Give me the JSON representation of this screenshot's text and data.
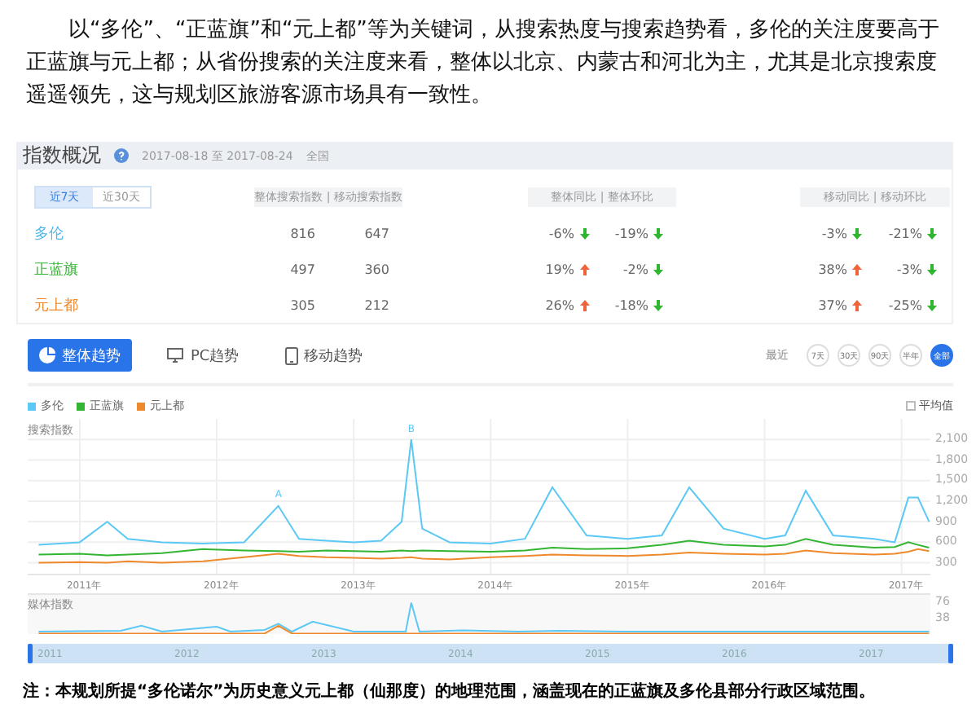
{
  "paragraph": "以“多伦”、“正蓝旗”和“元上都”等为关键词，从搜索热度与搜索趋势看，多伦的关注度要高于正蓝旗与元上都；从省份搜索的关注度来看，整体以北京、内蒙古和河北为主，尤其是北京搜索度遥遥领先，这与规划区旅游客源市场具有一致性。",
  "summary": {
    "title": "指数概况",
    "date_range": "2017-08-18 至 2017-08-24",
    "region": "全国",
    "periods": [
      {
        "label": "近7天",
        "selected": true
      },
      {
        "label": "近30天",
        "selected": false
      }
    ],
    "header_groups": [
      [
        "整体搜索指数",
        "移动搜索指数"
      ],
      [
        "整体同比",
        "整体环比"
      ],
      [
        "移动同比",
        "移动环比"
      ]
    ],
    "separator": "|",
    "rows": [
      {
        "name": "多伦",
        "color": "#4fb6ea",
        "values": [
          {
            "text": "816"
          },
          {
            "text": "647"
          },
          {
            "text": "-6%",
            "rising": false
          },
          {
            "text": "-19%",
            "rising": false
          },
          {
            "text": "-3%",
            "rising": false
          },
          {
            "text": "-21%",
            "rising": false
          }
        ]
      },
      {
        "name": "正蓝旗",
        "color": "#33b533",
        "values": [
          {
            "text": "497"
          },
          {
            "text": "360"
          },
          {
            "text": "19%",
            "rising": true
          },
          {
            "text": "-2%",
            "rising": false
          },
          {
            "text": "38%",
            "rising": true
          },
          {
            "text": "-3%",
            "rising": false
          }
        ]
      },
      {
        "name": "元上都",
        "color": "#ef8a2c",
        "values": [
          {
            "text": "305"
          },
          {
            "text": "212"
          },
          {
            "text": "26%",
            "rising": true
          },
          {
            "text": "-18%",
            "rising": false
          },
          {
            "text": "37%",
            "rising": true
          },
          {
            "text": "-25%",
            "rising": false
          }
        ]
      }
    ]
  },
  "trend": {
    "modes": [
      {
        "label": "整体趋势",
        "kind": "all",
        "selected": true
      },
      {
        "label": "PC趋势",
        "kind": "pc",
        "selected": false
      },
      {
        "label": "移动趋势",
        "kind": "mobile",
        "selected": false
      }
    ],
    "range_label": "最近",
    "ranges": [
      {
        "label": "7天",
        "selected": false
      },
      {
        "label": "30天",
        "selected": false
      },
      {
        "label": "90天",
        "selected": false
      },
      {
        "label": "半年",
        "selected": false
      },
      {
        "label": "全部",
        "selected": true
      }
    ],
    "average": {
      "label": "平均值",
      "checked": false
    },
    "chart_data": {
      "type": "line",
      "ylabel": "搜索指数",
      "x": [
        2010.7,
        2011.0,
        2011.2,
        2011.35,
        2011.6,
        2011.9,
        2012.2,
        2012.45,
        2012.6,
        2012.8,
        2013.0,
        2013.2,
        2013.35,
        2013.42,
        2013.5,
        2013.7,
        2014.0,
        2014.25,
        2014.45,
        2014.7,
        2015.0,
        2015.25,
        2015.45,
        2015.7,
        2016.0,
        2016.15,
        2016.3,
        2016.5,
        2016.8,
        2016.95,
        2017.05,
        2017.12,
        2017.2
      ],
      "series": [
        {
          "name": "多伦",
          "color": "#5cc8f5",
          "values": [
            560,
            600,
            900,
            650,
            600,
            580,
            600,
            1130,
            650,
            620,
            600,
            620,
            900,
            2100,
            800,
            600,
            580,
            650,
            1400,
            700,
            650,
            700,
            1400,
            800,
            650,
            700,
            1350,
            700,
            650,
            600,
            1250,
            1250,
            900
          ]
        },
        {
          "name": "正蓝旗",
          "color": "#33b533",
          "values": [
            420,
            430,
            410,
            420,
            440,
            500,
            480,
            470,
            460,
            480,
            470,
            460,
            480,
            470,
            480,
            470,
            460,
            480,
            520,
            500,
            510,
            560,
            620,
            560,
            540,
            560,
            650,
            560,
            520,
            530,
            600,
            560,
            520
          ]
        },
        {
          "name": "元上都",
          "color": "#ef8a2c",
          "values": [
            300,
            310,
            300,
            320,
            300,
            320,
            380,
            430,
            400,
            380,
            370,
            360,
            370,
            380,
            360,
            350,
            380,
            400,
            420,
            410,
            400,
            420,
            450,
            430,
            420,
            430,
            480,
            440,
            420,
            430,
            460,
            500,
            470
          ]
        }
      ],
      "grid": true,
      "xlim": [
        2010.62,
        2017.21
      ],
      "ylim": [
        140,
        2400
      ],
      "xticks": [
        {
          "value": 2011,
          "label": "2011年"
        },
        {
          "value": 2012,
          "label": "2012年"
        },
        {
          "value": 2013,
          "label": "2013年"
        },
        {
          "value": 2014,
          "label": "2014年"
        },
        {
          "value": 2015,
          "label": "2015年"
        },
        {
          "value": 2016,
          "label": "2016年"
        },
        {
          "value": 2017,
          "label": "2017年"
        }
      ],
      "yticks": [
        {
          "value": 2100,
          "label": "2,100"
        },
        {
          "value": 1800,
          "label": "1,800"
        },
        {
          "value": 1500,
          "label": "1,500"
        },
        {
          "value": 1200,
          "label": "1,200"
        },
        {
          "value": 900,
          "label": "900"
        },
        {
          "value": 600,
          "label": "600"
        },
        {
          "value": 300,
          "label": "300"
        }
      ],
      "annotations": [
        {
          "x": 2012.45,
          "y": 1130,
          "text": "A"
        },
        {
          "x": 2013.42,
          "y": 2100,
          "text": "B"
        }
      ]
    },
    "media": {
      "chart_data": {
        "type": "line",
        "ylabel": "媒体指数",
        "x": [
          2010.7,
          2011.3,
          2011.45,
          2011.6,
          2011.9,
          2012.0,
          2012.1,
          2012.35,
          2012.45,
          2012.55,
          2012.7,
          2013.0,
          2013.38,
          2013.42,
          2013.48,
          2013.8,
          2014.2,
          2014.5,
          2015.0,
          2016.0,
          2017.2
        ],
        "series": [
          {
            "color": "#5cc8f5",
            "values": [
              6,
              8,
              20,
              6,
              15,
              18,
              6,
              10,
              25,
              6,
              30,
              6,
              6,
              76,
              6,
              9,
              6,
              8,
              6,
              6,
              6
            ]
          },
          {
            "color": "#ef8a2c",
            "values": [
              1,
              1,
              1,
              1,
              1,
              1,
              1,
              1,
              20,
              1,
              1,
              1,
              1,
              1,
              1,
              1,
              1,
              1,
              1,
              1,
              1
            ]
          }
        ],
        "xlim": [
          2010.62,
          2017.21
        ],
        "ylim": [
          0,
          95
        ],
        "yticks": [
          {
            "value": 76,
            "label": "76"
          },
          {
            "value": 38,
            "label": "38"
          }
        ]
      }
    },
    "slider": {
      "level": 1,
      "ticks": [
        "2011",
        "2012",
        "2013",
        "2014",
        "2015",
        "2016",
        "2017"
      ]
    }
  },
  "note": "注：本规划所提“多伦诺尔”为历史意义元上都（仙那度）的地理范围，涵盖现在的正蓝旗及多伦县部分行政区域范围。"
}
